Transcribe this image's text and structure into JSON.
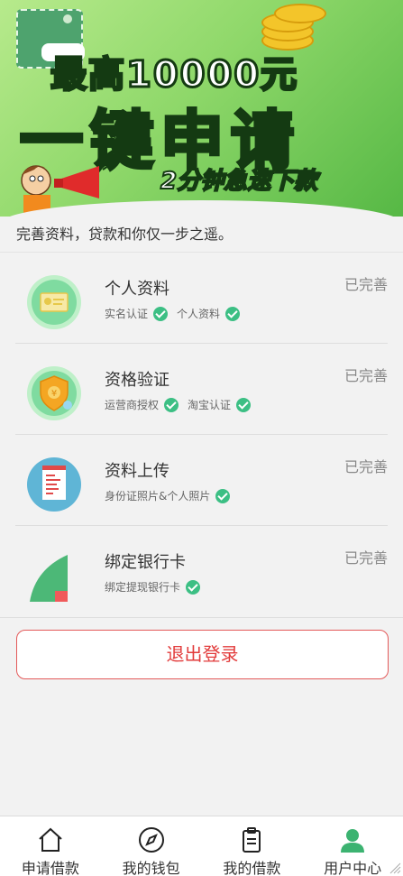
{
  "banner": {
    "line1": "最高10000元",
    "line2": "一键申请",
    "line3": "2分钟急速下款"
  },
  "subtitle": "完善资料，贷款和你仅一步之遥。",
  "items": [
    {
      "title": "个人资料",
      "status": "已完善",
      "tags": [
        "实名认证",
        "个人资料"
      ],
      "icon": "id-card-icon"
    },
    {
      "title": "资格验证",
      "status": "已完善",
      "tags": [
        "运营商授权",
        "淘宝认证"
      ],
      "icon": "shield-yuan-icon"
    },
    {
      "title": "资料上传",
      "status": "已完善",
      "tags": [
        "身份证照片&个人照片"
      ],
      "icon": "document-upload-icon"
    },
    {
      "title": "绑定银行卡",
      "status": "已完善",
      "tags": [
        "绑定提现银行卡"
      ],
      "icon": "bank-card-icon"
    }
  ],
  "logout_label": "退出登录",
  "tabs": [
    {
      "label": "申请借款",
      "icon": "home-icon"
    },
    {
      "label": "我的钱包",
      "icon": "compass-icon"
    },
    {
      "label": "我的借款",
      "icon": "clipboard-icon"
    },
    {
      "label": "用户中心",
      "icon": "user-icon"
    }
  ],
  "colors": {
    "accent_green": "#3cbf84",
    "logout_red": "#e23b3b",
    "banner_green": "#8fd86a"
  }
}
